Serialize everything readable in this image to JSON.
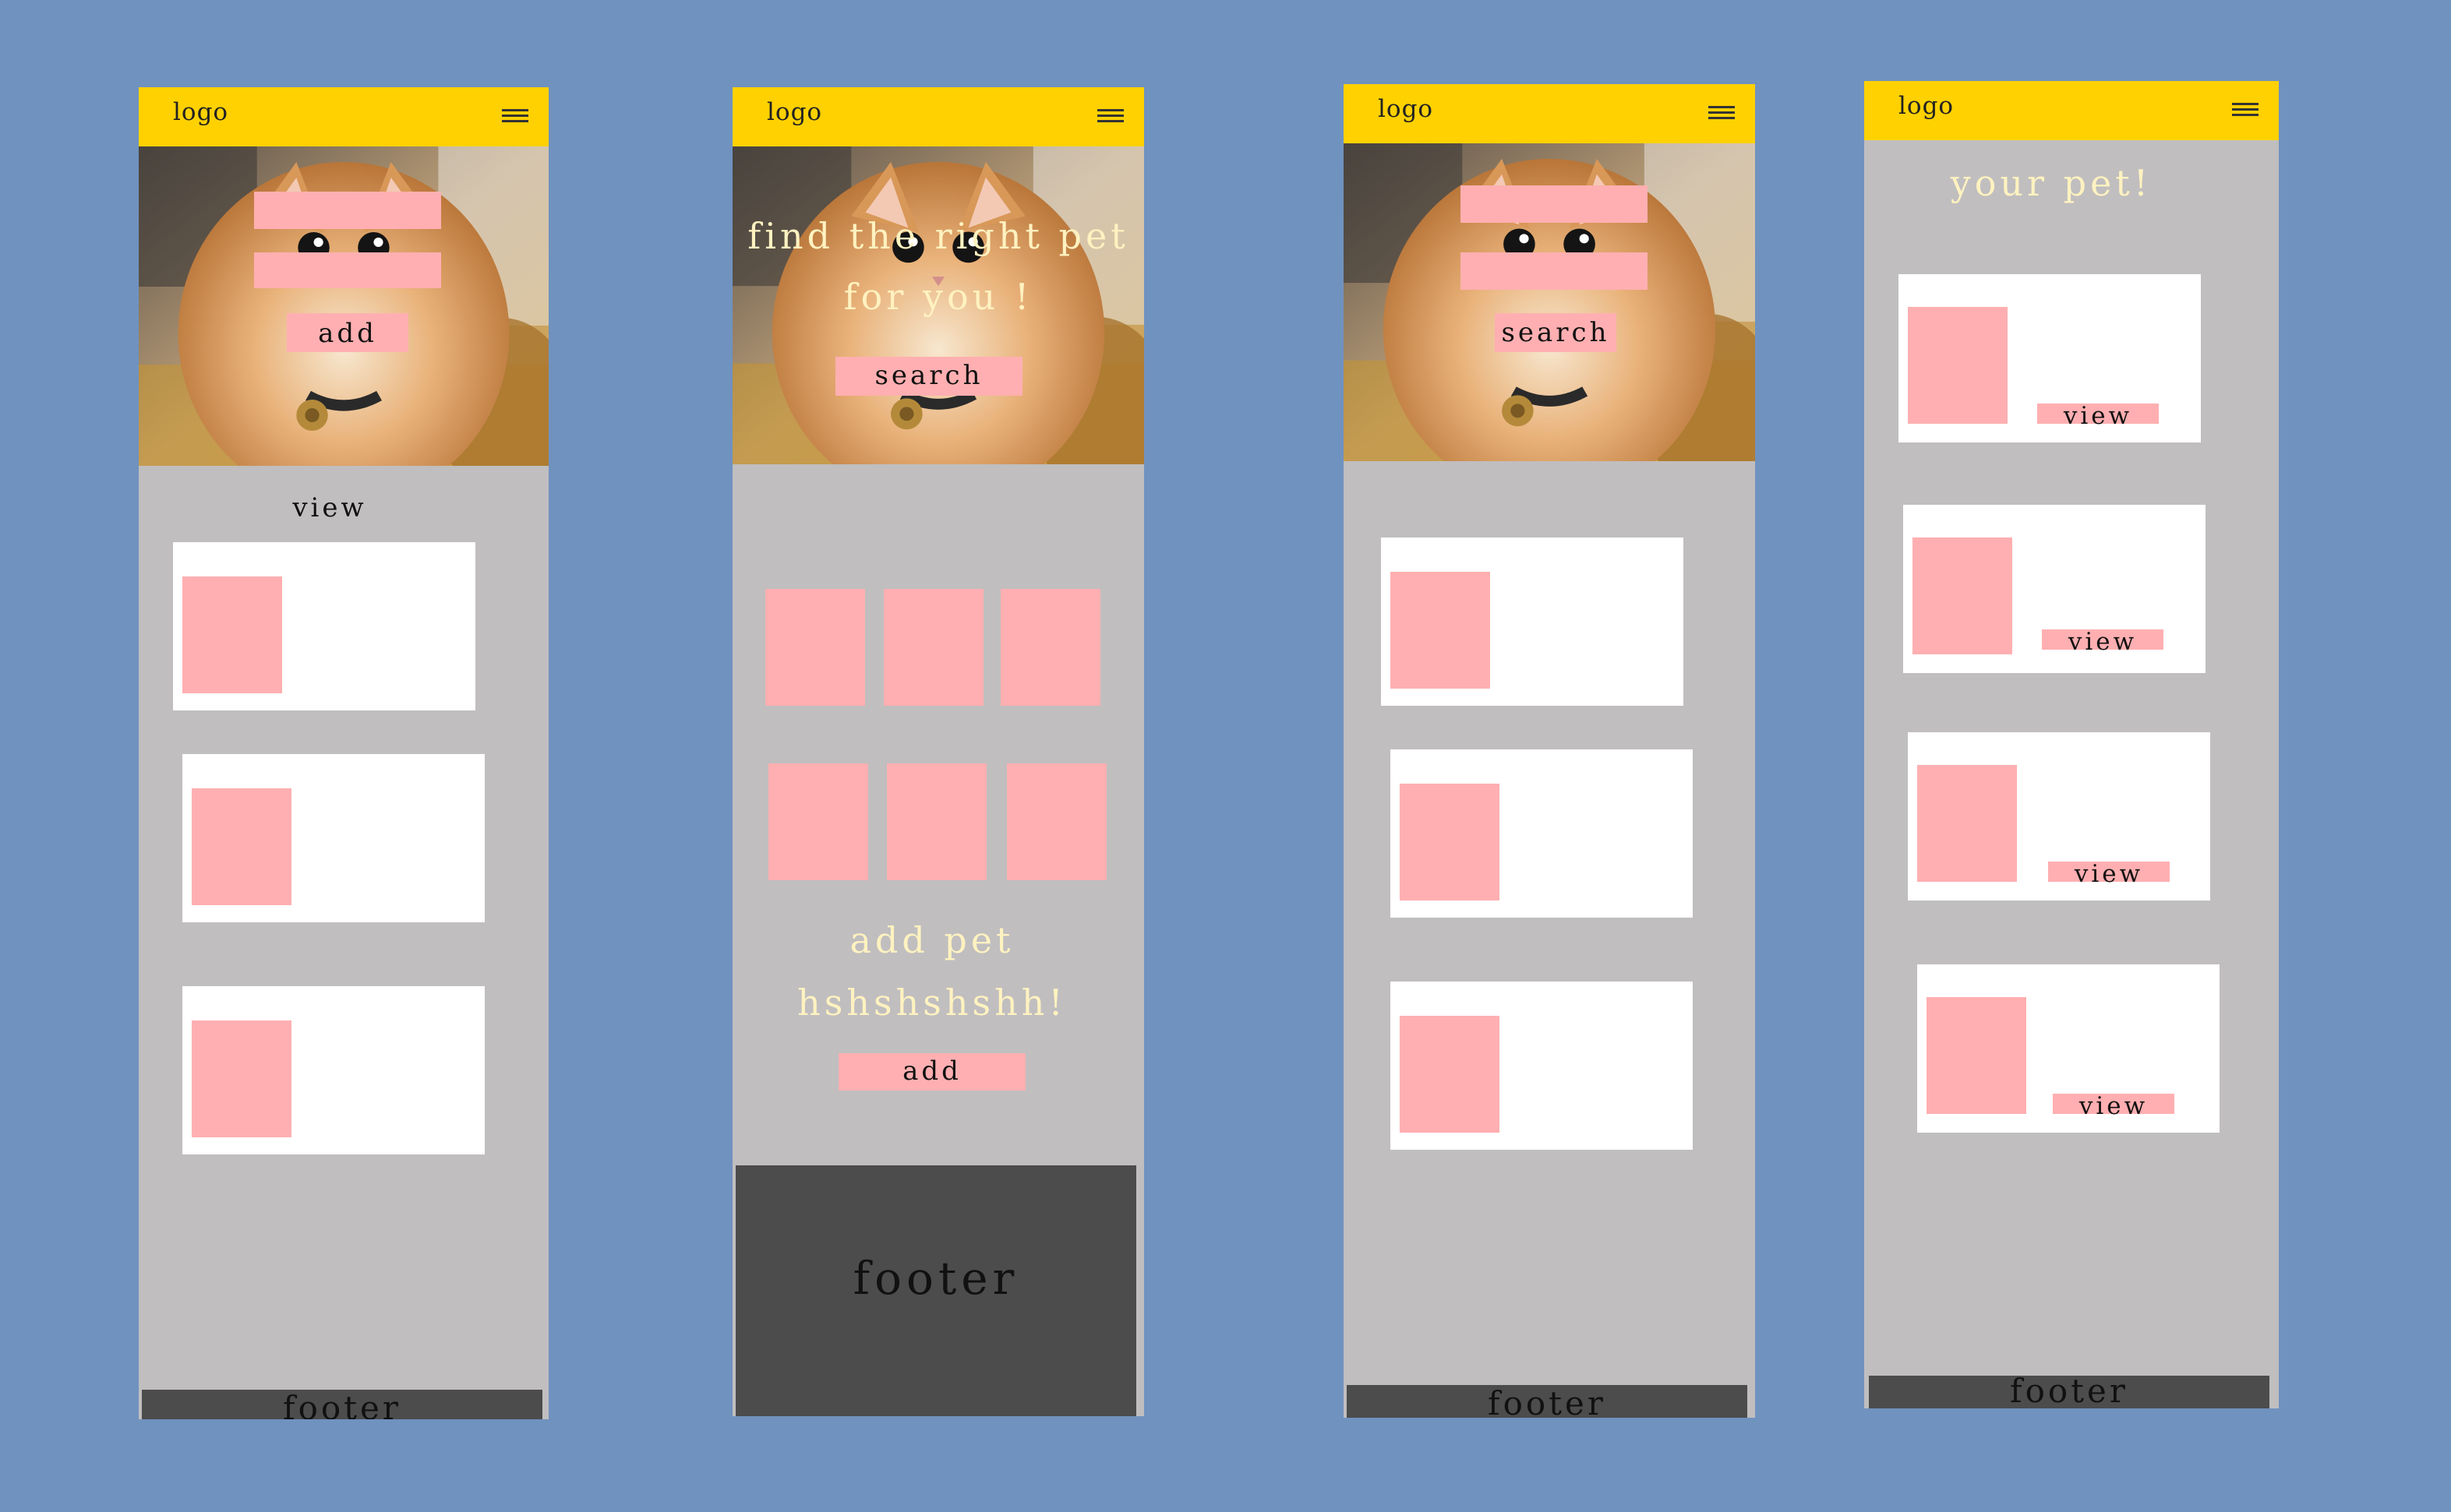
{
  "screens": [
    {
      "logo": "logo",
      "hero_button": "add",
      "section_label": "view",
      "footer": "footer"
    },
    {
      "logo": "logo",
      "hero_heading_line1": "find the right pet",
      "hero_heading_line2": "for you !",
      "hero_button": "search",
      "add_heading_line1": "add pet",
      "add_heading_line2": "hshshshshh!",
      "add_button": "add",
      "footer": "footer"
    },
    {
      "logo": "logo",
      "hero_button": "search",
      "footer": "footer"
    },
    {
      "logo": "logo",
      "heading": "your pet!",
      "cards": [
        {
          "button": "view"
        },
        {
          "button": "view"
        },
        {
          "button": "view"
        },
        {
          "button": "view"
        }
      ],
      "footer": "footer"
    }
  ],
  "icons": {
    "menu": "hamburger-menu-icon"
  },
  "colors": {
    "canvas": "#7092bf",
    "header": "#ffd100",
    "placeholder": "#ffafb1",
    "screen_bg": "#c0bebf",
    "card": "#ffffff",
    "footer": "#4c4c4c",
    "accent_text": "#fff2c0"
  }
}
